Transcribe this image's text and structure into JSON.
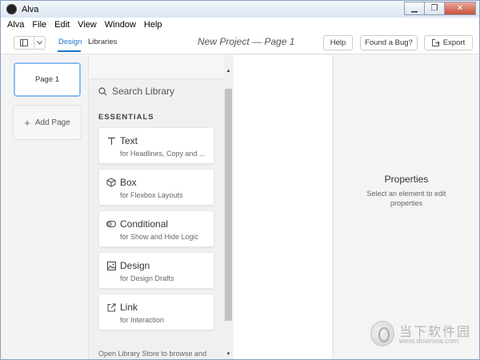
{
  "window": {
    "title": "Alva"
  },
  "menubar": {
    "items": [
      "Alva",
      "File",
      "Edit",
      "View",
      "Window",
      "Help"
    ]
  },
  "toolbar": {
    "tabs": {
      "design": "Design",
      "libraries": "Libraries"
    },
    "project_title": "New Project — Page 1",
    "help_label": "Help",
    "bug_label": "Found a Bug?",
    "export_label": "Export"
  },
  "pages": {
    "items": [
      {
        "label": "Page 1"
      }
    ],
    "add_label": "Add Page"
  },
  "library": {
    "search_placeholder": "Search Library",
    "section_title": "ESSENTIALS",
    "items": [
      {
        "name": "Text",
        "desc": "for Headlines, Copy and ...",
        "icon": "text-icon"
      },
      {
        "name": "Box",
        "desc": "for Flexbox Layouts",
        "icon": "box-icon"
      },
      {
        "name": "Conditional",
        "desc": "for Show and Hide Logic",
        "icon": "toggle-icon"
      },
      {
        "name": "Design",
        "desc": "for Design Drafts",
        "icon": "image-icon"
      },
      {
        "name": "Link",
        "desc": "for Interaction",
        "icon": "external-link-icon"
      }
    ],
    "footer_text": "Open Library Store to browse and"
  },
  "properties": {
    "title": "Properties",
    "hint": "Select an element to edit properties"
  },
  "watermark": {
    "text": "当下软件园",
    "url": "www.downxia.com"
  }
}
